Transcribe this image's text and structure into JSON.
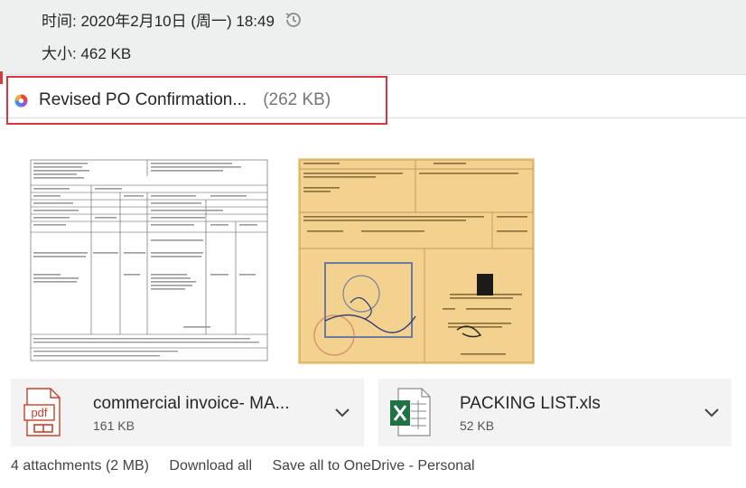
{
  "meta": {
    "time_text": "时间: 2020年2月10日 (周一) 18:49",
    "size_text": "大小: 462 KB"
  },
  "highlighted_attachment": {
    "name": "Revised PO Confirmation...",
    "size": "(262 KB)"
  },
  "attachments": [
    {
      "name": "commercial invoice- MA...",
      "size": "161 KB",
      "icon": "pdf-icon"
    },
    {
      "name": "PACKING LIST.xls",
      "size": "52 KB",
      "icon": "excel-icon"
    }
  ],
  "footer": {
    "count": "4 attachments (2 MB)",
    "download_all": "Download all",
    "save_onedrive": "Save all to OneDrive - Personal"
  },
  "colors": {
    "highlight_border": "#d9363e",
    "pdf_red": "#c7402d",
    "excel_green": "#1f7244",
    "meta_bg": "#eef0f0"
  }
}
